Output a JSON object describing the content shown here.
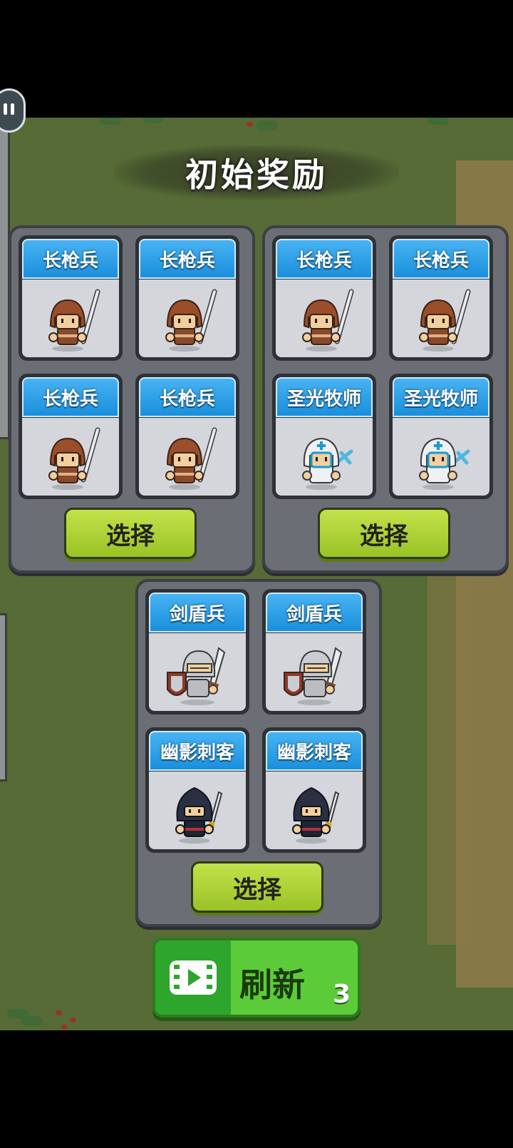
{
  "title": "初始奖励",
  "select_label": "选择",
  "refresh": {
    "label": "刷新",
    "count": "3"
  },
  "groups": [
    {
      "units": [
        {
          "name": "长枪兵",
          "type": "spearman"
        },
        {
          "name": "长枪兵",
          "type": "spearman"
        },
        {
          "name": "长枪兵",
          "type": "spearman"
        },
        {
          "name": "长枪兵",
          "type": "spearman"
        }
      ]
    },
    {
      "units": [
        {
          "name": "长枪兵",
          "type": "spearman"
        },
        {
          "name": "长枪兵",
          "type": "spearman"
        },
        {
          "name": "圣光牧师",
          "type": "priest"
        },
        {
          "name": "圣光牧师",
          "type": "priest"
        }
      ]
    },
    {
      "units": [
        {
          "name": "剑盾兵",
          "type": "knight"
        },
        {
          "name": "剑盾兵",
          "type": "knight"
        },
        {
          "name": "幽影刺客",
          "type": "assassin"
        },
        {
          "name": "幽影刺客",
          "type": "assassin"
        }
      ]
    }
  ],
  "icons": {
    "pause": "pause-icon",
    "video": "video-ad-icon"
  }
}
